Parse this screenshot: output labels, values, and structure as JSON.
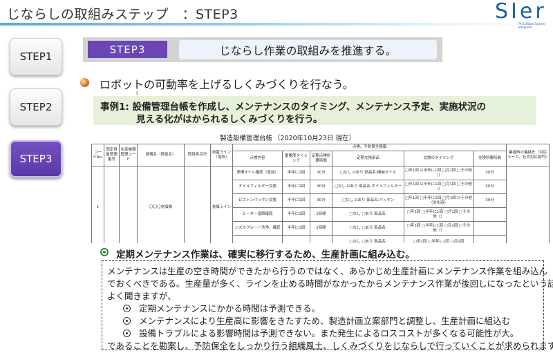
{
  "header": {
    "title": "じならしの取組みステップ　：STEP3",
    "logo_text": "SIer",
    "logo_sub": "FA & Robot System Integrator"
  },
  "steps": [
    {
      "label": "STEP1",
      "active": false
    },
    {
      "label": "STEP2",
      "active": false
    },
    {
      "label": "STEP3",
      "active": true
    }
  ],
  "band": {
    "tag": "STEP3",
    "text": "じならし作業の取組みを推進する。"
  },
  "bullet": "ロボットの可動率を上げるしくみづくりを行なう。",
  "example": {
    "line1": "事例1: 設備管理台帳を作成し、メンテナンスのタイミング、メンテナンス予定、実施状況の",
    "line2": "見える化がはかられるしくみづくりを行う。"
  },
  "ledger": {
    "title": "製造設備管理台帳",
    "date": "（2020年10月23日 現在）",
    "top_group": "点検、予防保全情報",
    "headers": [
      "コードNo.",
      "固定資産管理番号",
      "生産機器管理コード",
      "設備名（資産名）",
      "取得年月日",
      "設置ライン（場所）",
      "点検内容",
      "重要度タイミング",
      "定期点検所要時間",
      "定期交換部品",
      "交換のタイミング",
      "交換所要時間",
      "業者時の連絡先（対応メーカ、社内対応部門）"
    ],
    "code": "1",
    "equipment": "〇〇〇充填機",
    "line": "充填ライン",
    "rows": [
      {
        "item": "潤滑オイル確認（追加）",
        "freq": "半年に1回",
        "time": "30分",
        "part": "□なし ☑あり 部品名:機械オイル",
        "timing": "□年1回 ☑半年に1回 □月1回 □その他（）",
        "swap": "30分"
      },
      {
        "item": "オイルフィルター交換",
        "freq": "半年に1回",
        "time": "30分",
        "part": "□なし ☑あり 部品名:オイルフィルター",
        "timing": "□年1回 ☑半年に1回 □月1回 □その他（）",
        "swap": "30分"
      },
      {
        "item": "ピストンパッキン交換",
        "freq": "半年に1回",
        "time": "30分",
        "part": "□なし ☑あり 部品名:パッキン",
        "timing": "□年1回 □半年に1回 □月1回 ☑その他（劣化時）",
        "swap": "30分"
      },
      {
        "item": "ヒーター温調確認",
        "freq": "半年に1回",
        "time": "1時間",
        "part": "□なし □あり 部品名:",
        "timing": "□年1回 □半年に1回 □月1回 □その他（）",
        "swap": ""
      },
      {
        "item": "ノズルプレート洗浄、確認",
        "freq": "半年に1回",
        "time": "1時間",
        "part": "□なし □あり 部品名:",
        "timing": "□年1回 □半年に1回 □月1回 □その他（）",
        "swap": ""
      },
      {
        "item": "",
        "freq": "",
        "time": "",
        "part": "□なし □あり 部品名:",
        "timing": "□年1回 □半年に1回 □月1回",
        "swap": ""
      }
    ]
  },
  "policy": {
    "heading": "定期メンテナンス作業は、確実に移行するため、生産計画に組み込む。",
    "line1": "メンテナンスは生産の空き時間ができたから行うのではなく、あらかじめ生産計画にメンテナンス作業を組み込ん",
    "line2": "でおくべきである。生産量が多く、ラインを止める時間がなかったからメンテナンス作業が後回しになったという話を",
    "line3": "よく聞きますが、",
    "items": [
      "定期メンテナンスにかかる時間は予測できる。",
      "メンテナンスにより生産高に影響をきたすため、製造計画立案部門と調整し、生産計画に組込む",
      "設備トラブルによる影響時間は予測できない。また発生によるロスコストが多くなる可能性が大。"
    ],
    "closing": "であることを勘案し、予防保全をしっかり行う組織風土、しくみづくりをじならしで行っていくことが求められます。。"
  },
  "colors": {
    "accent": "#6a46b6",
    "header_rule": "#5fa8d8",
    "example_bg": "#e6f1d9",
    "logo": "#1f5f9c"
  }
}
